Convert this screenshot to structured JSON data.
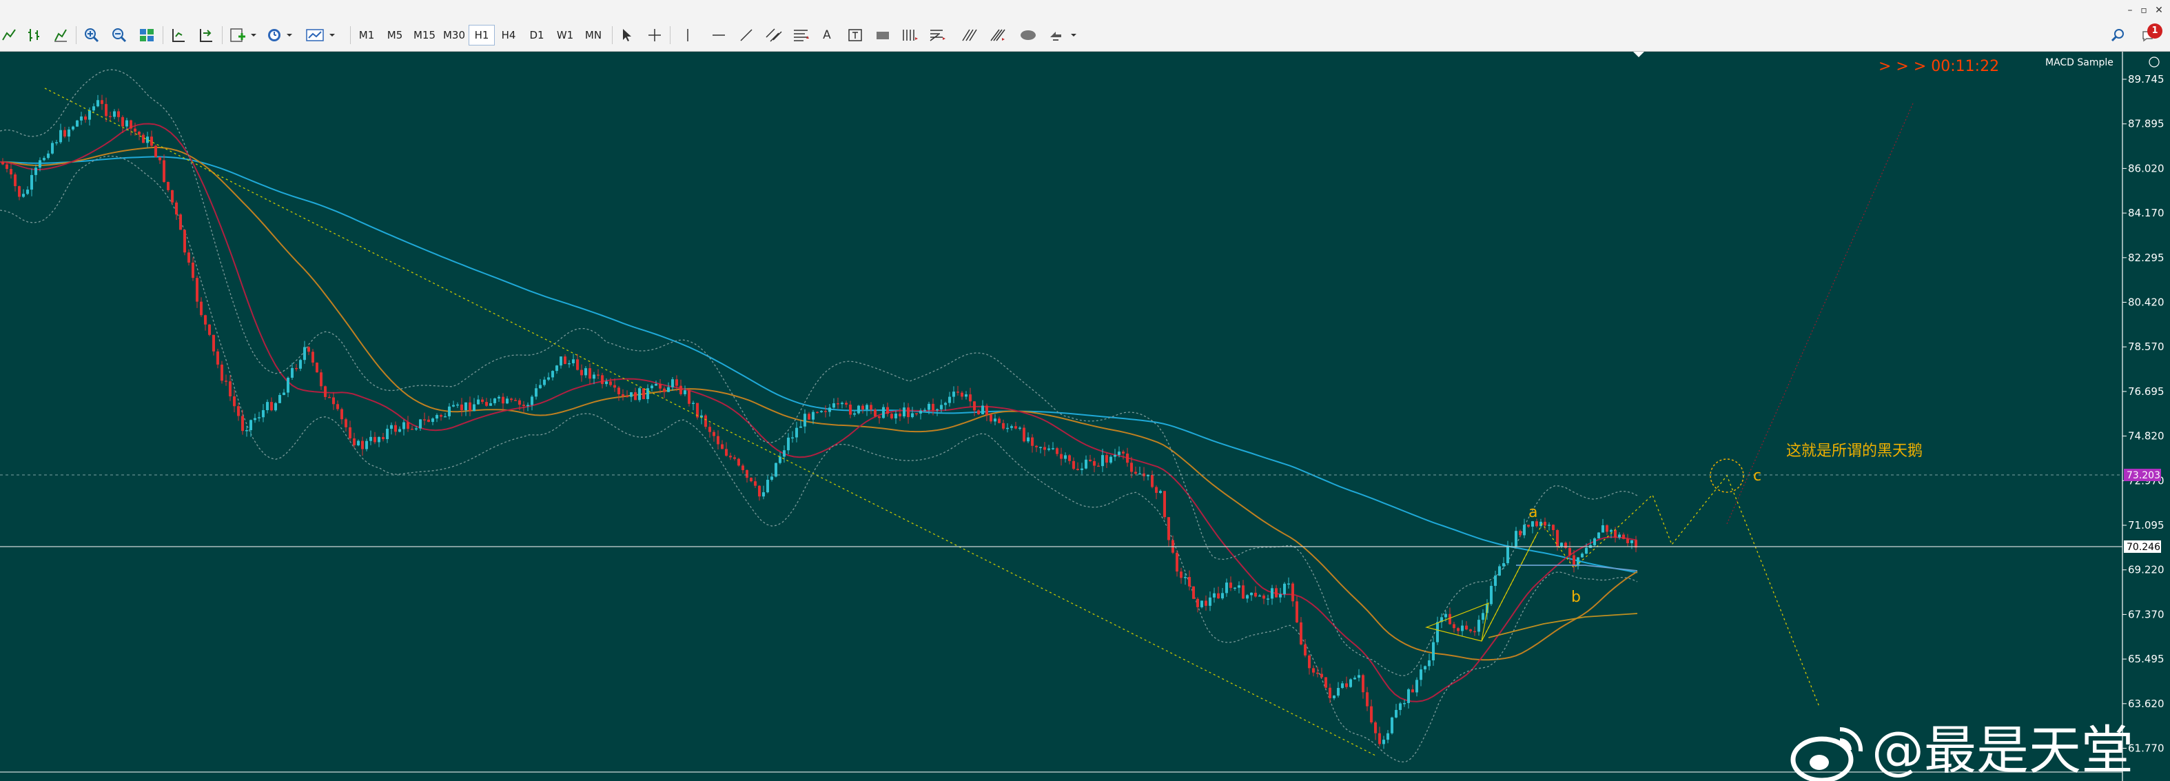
{
  "window": {
    "minimize_glyph": "–",
    "restore_glyph": "▫",
    "close_glyph": "✕"
  },
  "toolbar": {
    "timeframes": [
      {
        "label": "M1",
        "active": false
      },
      {
        "label": "M5",
        "active": false
      },
      {
        "label": "M15",
        "active": false
      },
      {
        "label": "M30",
        "active": false
      },
      {
        "label": "H1",
        "active": true
      },
      {
        "label": "H4",
        "active": false
      },
      {
        "label": "D1",
        "active": false
      },
      {
        "label": "W1",
        "active": false
      },
      {
        "label": "MN",
        "active": false
      }
    ],
    "text_tool_label": "A",
    "notification_count": "1"
  },
  "chart": {
    "timer": "> > >  00:11:22",
    "expert_name": "MACD Sample",
    "annotation": "这就是所谓的黑天鹅",
    "wave_labels": [
      "a",
      "b",
      "c"
    ],
    "price_levels": [
      "89.745",
      "87.895",
      "86.020",
      "84.170",
      "82.295",
      "80.420",
      "78.570",
      "76.695",
      "74.820",
      "72.970",
      "71.095",
      "69.220",
      "67.370",
      "65.495",
      "63.620",
      "61.770"
    ],
    "highlight_price": "73.203",
    "current_price": "70.246",
    "watermark": "@最是天堂",
    "colors": {
      "background": "#004040",
      "bull_candle": "#30c0d0",
      "bear_candle": "#e03030",
      "timer": "#ff4000",
      "annotation": "#f0b000"
    }
  }
}
